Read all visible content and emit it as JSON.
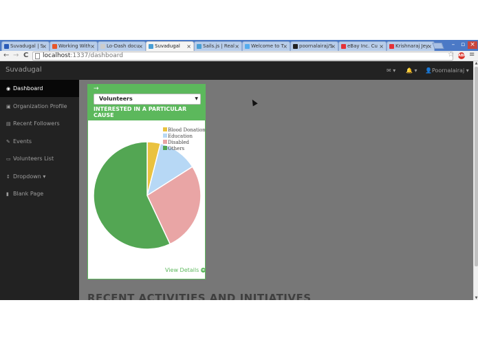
{
  "browser": {
    "tabs": [
      {
        "title": "Suvadugal | S",
        "fav": "#2a5bb8"
      },
      {
        "title": "Working With",
        "fav": "#e8562a"
      },
      {
        "title": "Lo-Dash docu",
        "fav": "#cccccc"
      },
      {
        "title": "Suvadugal",
        "fav": "#4a9fd5",
        "active": true
      },
      {
        "title": "Sails.js | Real",
        "fav": "#4a9fd5"
      },
      {
        "title": "Welcome to T",
        "fav": "#55acee"
      },
      {
        "title": "poornalairaj/S",
        "fav": "#222222"
      },
      {
        "title": "eBay Inc. Cu",
        "fav": "#e53238"
      },
      {
        "title": "Krishnaraj Jey",
        "fav": "#e53238"
      }
    ],
    "tab_close": "×",
    "url_host": "localhost",
    "url_rest": ":1337/dashboard",
    "back_icon": "←",
    "forward_icon": "→",
    "reload_icon": "C",
    "star_icon": "☆",
    "abp_label": "ABP",
    "menu_icon": "≡",
    "win_min": "–",
    "win_max": "▫",
    "win_close": "×"
  },
  "navbar": {
    "brand": "Suvadugal",
    "envelope_icon": "✉ ▾",
    "bell_icon": "🔔 ▾",
    "user": "👤Poornalairaj ▾"
  },
  "sidebar": {
    "items": [
      {
        "icon": "◉",
        "label": "Dashboard",
        "active": true
      },
      {
        "icon": "▣",
        "label": "Organization Profile"
      },
      {
        "icon": "▤",
        "label": "Recent Followers"
      },
      {
        "icon": "✎",
        "label": "Events"
      },
      {
        "icon": "▭",
        "label": "Volunteers List"
      },
      {
        "icon": "↕",
        "label": "Dropdown ▾"
      },
      {
        "icon": "▮",
        "label": "Blank Page"
      }
    ]
  },
  "panel": {
    "arrow": "→",
    "select_value": "Volunteers",
    "caret": "▼",
    "title": "INTERESTED IN A PARTICULAR CAUSE",
    "view_details": "View Details",
    "view_details_icon": "➔"
  },
  "main": {
    "section_title": "RECENT ACTIVITIES AND INITIATIVES"
  },
  "chart_data": {
    "type": "pie",
    "legend": [
      "Blood Donation",
      "Education",
      "Disabled",
      "Others"
    ],
    "values": [
      4,
      12,
      27,
      57
    ],
    "colors": [
      "#eac23f",
      "#b7d8f5",
      "#e9a5a5",
      "#53a653"
    ],
    "legend_position": "top-right"
  }
}
